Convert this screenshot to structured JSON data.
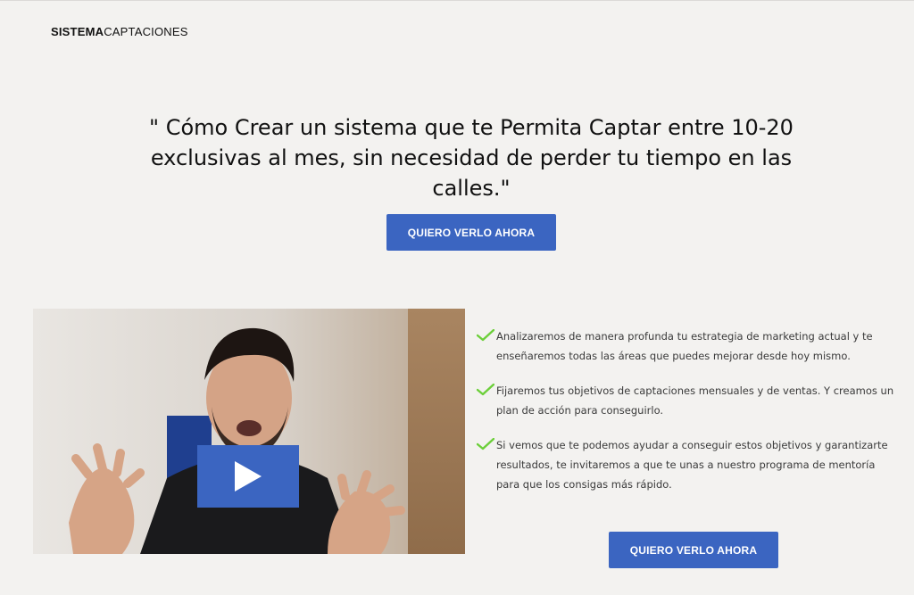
{
  "header": {
    "logo_bold": "SISTEMA",
    "logo_light": "CAPTACIONES"
  },
  "hero": {
    "headline": "\" Cómo Crear un sistema que te Permita Captar entre 10-20 exclusivas al mes, sin necesidad de perder tu tiempo en las calles.\"",
    "cta_label": "QUIERO VERLO AHORA"
  },
  "video": {
    "play_icon": "play-icon"
  },
  "benefits": {
    "items": [
      {
        "text": "Analizaremos de manera profunda tu estrategia de marketing actual y te enseñaremos todas las áreas que puedes mejorar desde hoy mismo."
      },
      {
        "text": "Fijaremos tus objetivos de captaciones mensuales y de ventas. Y creamos un plan de acción para conseguirlo."
      },
      {
        "text": "Si vemos que te podemos ayudar a conseguir estos objetivos y garantizarte resultados, te invitaremos a que te unas a nuestro programa de mentoría para que los consigas más rápido."
      }
    ],
    "cta_label": "QUIERO VERLO AHORA"
  },
  "colors": {
    "background": "#f3f2f0",
    "accent": "#3b65c1",
    "check": "#6ccf3a",
    "text": "#111111"
  }
}
